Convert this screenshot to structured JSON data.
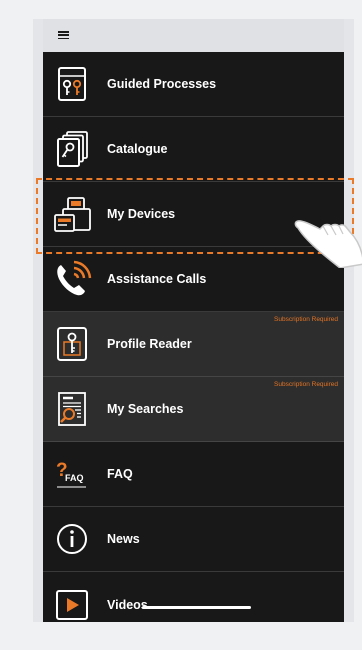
{
  "menu": {
    "items": [
      {
        "label": "Guided Processes",
        "icon": "guided-processes-icon"
      },
      {
        "label": "Catalogue",
        "icon": "catalogue-icon"
      },
      {
        "label": "My Devices",
        "icon": "devices-icon"
      },
      {
        "label": "Assistance Calls",
        "icon": "phone-icon"
      },
      {
        "label": "Profile Reader",
        "icon": "key-profile-icon",
        "note": "Subscription Required"
      },
      {
        "label": "My Searches",
        "icon": "search-document-icon",
        "note": "Subscription Required"
      },
      {
        "label": "FAQ",
        "icon": "faq-icon",
        "icon_text": "FAQ"
      },
      {
        "label": "News",
        "icon": "info-icon"
      },
      {
        "label": "Videos",
        "icon": "play-icon"
      }
    ]
  },
  "colors": {
    "accent": "#ea7a28",
    "menu_bg": "#181818",
    "subscription_bg": "#2d2d2d",
    "text": "#ffffff"
  },
  "overlay": {
    "highlight": "dashed-highlight-box",
    "pointer": "hand-pointer-icon"
  }
}
